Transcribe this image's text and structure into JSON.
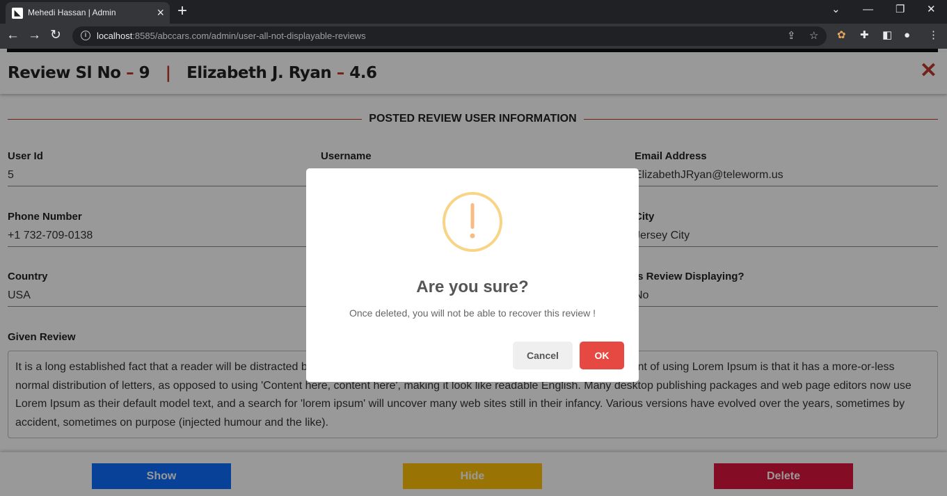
{
  "browser": {
    "tab_title": "Mehedi Hassan | Admin",
    "new_tab_symbol": "+",
    "url_host": "localhost",
    "url_rest": ":8585/abccars.com/admin/user-all-not-displayable-reviews"
  },
  "header": {
    "review_label": "Review Sl No",
    "dash": "–",
    "review_no": "9",
    "separator": "|",
    "reviewer_name": "Elizabeth J. Ryan",
    "rating": "4.6"
  },
  "section": {
    "heading": "POSTED REVIEW USER INFORMATION"
  },
  "fields": {
    "user_id": {
      "label": "User Id",
      "value": "5"
    },
    "username": {
      "label": "Username",
      "value": ""
    },
    "email": {
      "label": "Email Address",
      "value": "ElizabethJRyan@teleworm.us"
    },
    "phone": {
      "label": "Phone Number",
      "value": "+1 732-709-0138"
    },
    "city": {
      "label": "City",
      "value": "Jersey City"
    },
    "country": {
      "label": "Country",
      "value": "USA"
    },
    "displaying": {
      "label": "Is Review Displaying?",
      "value": "No"
    }
  },
  "given_review": {
    "label": "Given Review",
    "text": "It is a long established fact that a reader will be distracted by the readable content of a page when looking at its layout. The point of using Lorem Ipsum is that it has a more-or-less normal distribution of letters, as opposed to using 'Content here, content here', making it look like readable English. Many desktop publishing packages and web page editors now use Lorem Ipsum as their default model text, and a search for 'lorem ipsum' will uncover many web sites still in their infancy. Various versions have evolved over the years, sometimes by accident, sometimes on purpose (injected humour and the like)."
  },
  "actions": {
    "show": "Show",
    "hide": "Hide",
    "delete": "Delete"
  },
  "colors": {
    "show_btn": "#0d6efd",
    "hide_btn": "#ffc107",
    "delete_btn": "#dc143c",
    "accent_red": "#c0392b",
    "ok_btn": "#e64942",
    "warning": "#f8bb86"
  },
  "modal": {
    "icon": "warning-icon",
    "title": "Are you sure?",
    "text": "Once deleted, you will not be able to recover this review !",
    "cancel": "Cancel",
    "ok": "OK"
  }
}
